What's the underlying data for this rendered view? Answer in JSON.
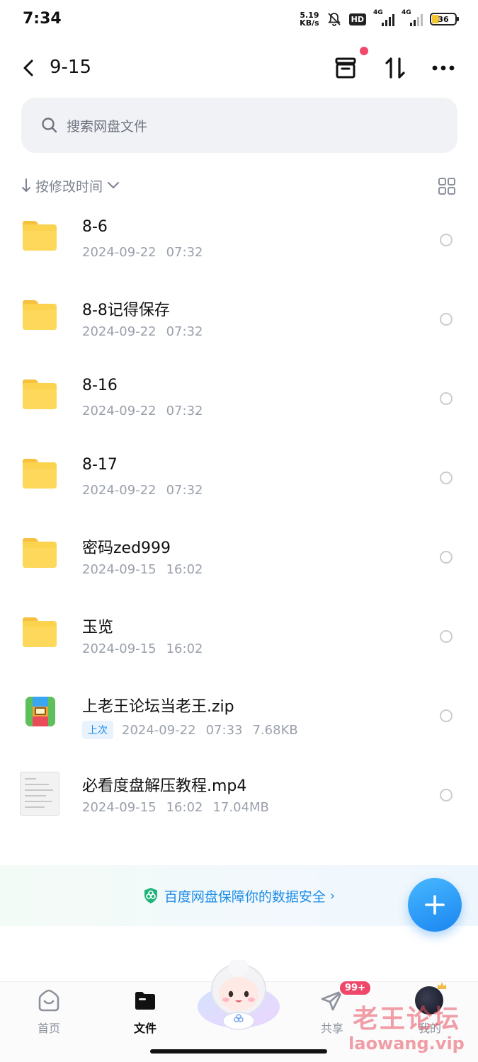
{
  "status_bar": {
    "time": "7:34",
    "net_speed_value": "5.19",
    "net_speed_unit": "KB/s",
    "hd_label": "HD",
    "signal1_label": "4G",
    "signal2_label": "4G",
    "battery": "36"
  },
  "header": {
    "title": "9-15"
  },
  "search": {
    "placeholder": "搜索网盘文件"
  },
  "sort": {
    "label": "按修改时间"
  },
  "files": [
    {
      "name": "8-6",
      "date": "2024-09-22",
      "time": "07:32",
      "type": "folder"
    },
    {
      "name": "8-8记得保存",
      "date": "2024-09-22",
      "time": "07:32",
      "type": "folder"
    },
    {
      "name": "8-16",
      "date": "2024-09-22",
      "time": "07:32",
      "type": "folder"
    },
    {
      "name": "8-17",
      "date": "2024-09-22",
      "time": "07:32",
      "type": "folder"
    },
    {
      "name": "密码zed999",
      "date": "2024-09-15",
      "time": "16:02",
      "type": "folder"
    },
    {
      "name": "玉览",
      "date": "2024-09-15",
      "time": "16:02",
      "type": "folder"
    },
    {
      "name": "上老王论坛当老王.zip",
      "badge": "上次",
      "date": "2024-09-22",
      "time": "07:33",
      "size": "7.68KB",
      "type": "zip"
    },
    {
      "name": "必看度盘解压教程.mp4",
      "date": "2024-09-15",
      "time": "16:02",
      "size": "17.04MB",
      "type": "video"
    }
  ],
  "banner": {
    "text": "百度网盘保障你的数据安全",
    "chevron": "›"
  },
  "fab": {
    "icon": "plus-icon"
  },
  "nav": {
    "home": "首页",
    "files": "文件",
    "share": "共享",
    "share_badge": "99+",
    "me": "我的"
  },
  "watermark": {
    "line1": "老王论坛",
    "line2": "laowang.vip"
  },
  "colors": {
    "accent": "#1b8ce8",
    "folder": "#fbd34f",
    "badge_red": "#f0486a"
  }
}
